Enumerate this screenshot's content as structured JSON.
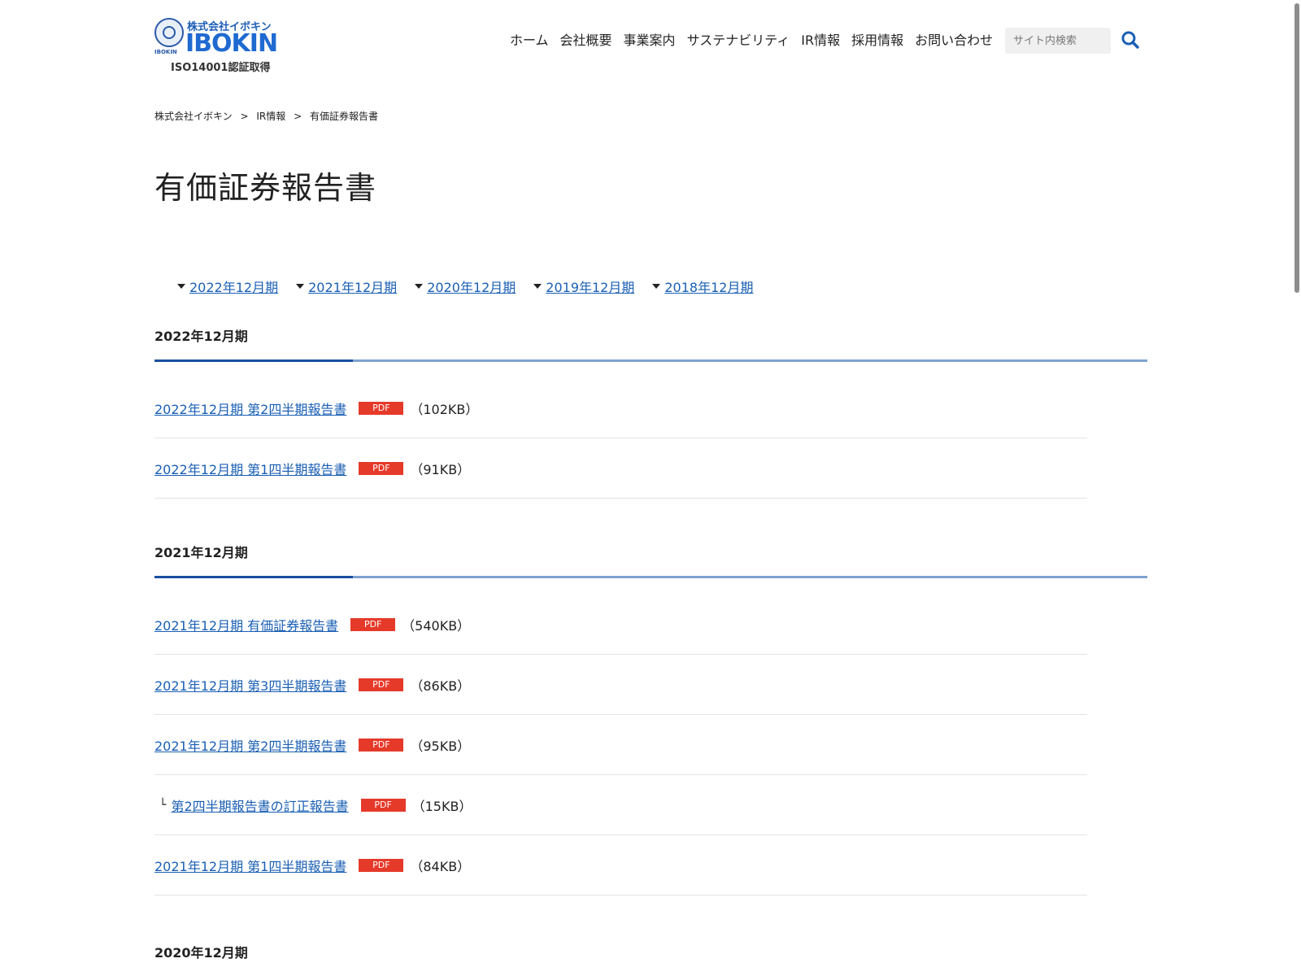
{
  "header": {
    "logo": {
      "kana": "株式会社イボキン",
      "name": "IBOKIN",
      "emblem_label": "IBOKIN",
      "iso": "ISO14001認証取得"
    },
    "nav": [
      "ホーム",
      "会社概要",
      "事業案内",
      "サステナビリティ",
      "IR情報",
      "採用情報",
      "お問い合わせ"
    ],
    "search": {
      "placeholder": "サイト内検索",
      "icon": "search-icon"
    }
  },
  "breadcrumb": [
    "株式会社イボキン",
    "IR情報",
    "有価証券報告書"
  ],
  "breadcrumb_sep": ">",
  "page_title": "有価証券報告書",
  "anchors": [
    "2022年12月期",
    "2021年12月期",
    "2020年12月期",
    "2019年12月期",
    "2018年12月期"
  ],
  "sections": [
    {
      "title": "2022年12月期",
      "items": [
        {
          "label": "2022年12月期 第2四半期報告書",
          "badge": "PDF",
          "size": "（102KB）",
          "child": false
        },
        {
          "label": "2022年12月期 第1四半期報告書",
          "badge": "PDF",
          "size": "（91KB）",
          "child": false
        }
      ]
    },
    {
      "title": "2021年12月期",
      "items": [
        {
          "label": "2021年12月期 有価証券報告書",
          "badge": "PDF",
          "size": "（540KB）",
          "child": false
        },
        {
          "label": "2021年12月期 第3四半期報告書",
          "badge": "PDF",
          "size": "（86KB）",
          "child": false
        },
        {
          "label": "2021年12月期 第2四半期報告書",
          "badge": "PDF",
          "size": "（95KB）",
          "child": false
        },
        {
          "label": "第2四半期報告書の訂正報告書",
          "badge": "PDF",
          "size": "（15KB）",
          "child": true,
          "prefix": "└"
        },
        {
          "label": "2021年12月期 第1四半期報告書",
          "badge": "PDF",
          "size": "（84KB）",
          "child": false
        }
      ]
    },
    {
      "title": "2020年12月期",
      "items": []
    }
  ],
  "colors": {
    "link": "#1a5fb4",
    "pdf_badge": "#e53a2a",
    "rule_accent": "#1a4fa0",
    "rule": "#7ea2cf"
  }
}
